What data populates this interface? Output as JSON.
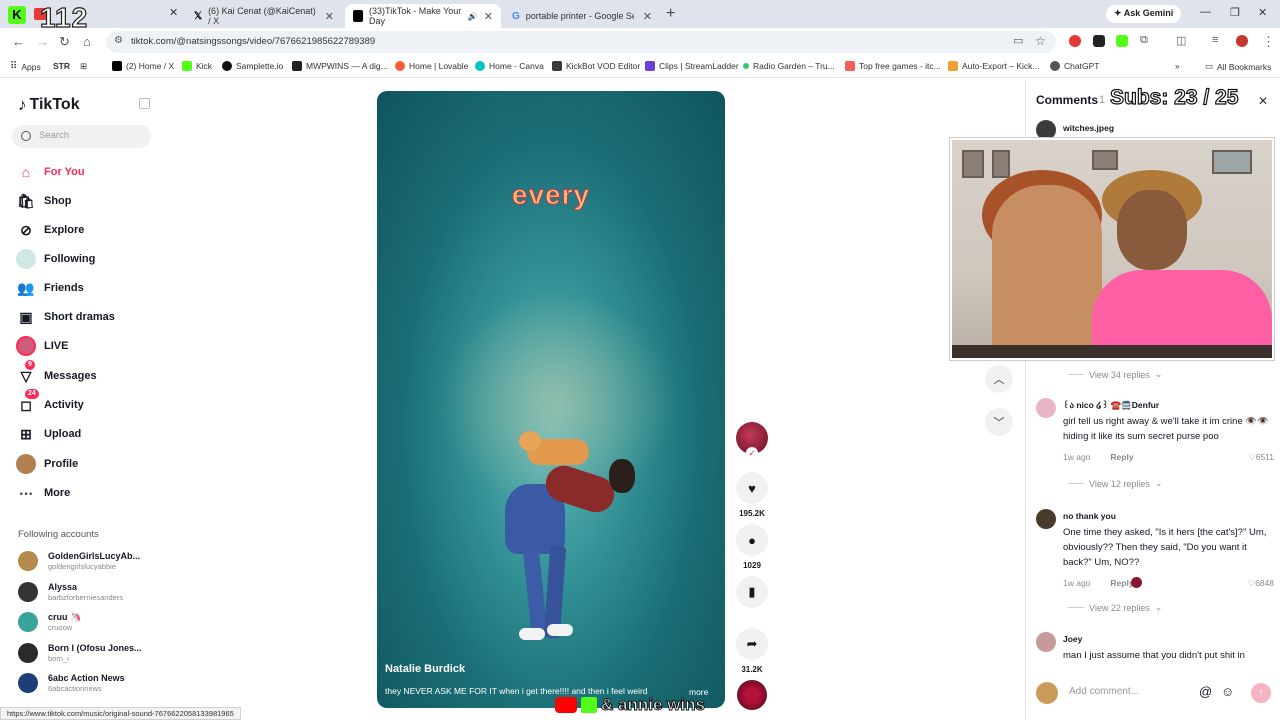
{
  "browser": {
    "overlay_count": "112",
    "tabs": [
      {
        "title": "(6) Kai Cenat (@KaiCenat) / X",
        "fav": "#000000"
      },
      {
        "title": "(33)TikTok - Make Your Day",
        "fav": "#000000"
      },
      {
        "title": "portable printer - Google Search",
        "fav": "#4285f4"
      }
    ],
    "new_tab": "+",
    "gemini": "Ask Gemini",
    "url": "tiktok.com/@natsingssongs/video/7676621985622789389",
    "bookmarks": [
      "Apps",
      "STR",
      "(2) Home / X",
      "Kick",
      "Samplette.io",
      "MWPWINS — A dig...",
      "Home | Lovable",
      "Home - Canva",
      "KickBot VOD Editor",
      "Clips | StreamLadder",
      "Radio Garden – Tru...",
      "Top free games - itc...",
      "Auto-Export – Kick...",
      "ChatGPT"
    ],
    "all_bookmarks": "All Bookmarks",
    "status_url": "https://www.tiktok.com/music/original-sound-7676622058133981965"
  },
  "sidebar": {
    "logo": "TikTok",
    "search_placeholder": "Search",
    "nav": [
      {
        "label": "For You",
        "icon": "home-icon",
        "glyph": "⌂"
      },
      {
        "label": "Shop",
        "icon": "shop-bag-icon",
        "glyph": "🛍"
      },
      {
        "label": "Explore",
        "icon": "compass-icon",
        "glyph": "⊘"
      },
      {
        "label": "Following",
        "icon": "following-avatar-icon",
        "glyph": ""
      },
      {
        "label": "Friends",
        "icon": "friends-icon",
        "glyph": "👥"
      },
      {
        "label": "Short dramas",
        "icon": "film-icon",
        "glyph": "▣"
      },
      {
        "label": "LIVE",
        "icon": "live-avatar-icon",
        "glyph": ""
      },
      {
        "label": "Messages",
        "icon": "messages-icon",
        "glyph": "▽",
        "badge": "9"
      },
      {
        "label": "Activity",
        "icon": "activity-icon",
        "glyph": "◻",
        "badge": "24"
      },
      {
        "label": "Upload",
        "icon": "upload-icon",
        "glyph": "⊞"
      },
      {
        "label": "Profile",
        "icon": "profile-avatar-icon",
        "glyph": ""
      },
      {
        "label": "More",
        "icon": "more-icon",
        "glyph": "⋯"
      }
    ],
    "following_header": "Following accounts",
    "accounts": [
      {
        "name": "GoldenGirlsLucyAb...",
        "handle": "goldengirlslucyabbie",
        "color": "#b58a4a"
      },
      {
        "name": "Alyssa",
        "handle": "barbzforberniesanders",
        "color": "#333333"
      },
      {
        "name": "cruu 🦄",
        "handle": "cruoow",
        "color": "#3aa39a"
      },
      {
        "name": "Born I (Ofosu Jones...",
        "handle": "born_i",
        "color": "#2a2a2a"
      },
      {
        "name": "6abc Action News",
        "handle": "6abcactionnews",
        "color": "#1d3e78"
      }
    ]
  },
  "video": {
    "caption_word": "every",
    "author": "Natalie Burdick",
    "description": "they NEVER ASK ME FOR IT when i get there!!!! and then i feel weird",
    "more": "more",
    "stream_overlay": "& annie wins"
  },
  "actions": {
    "likes": "195.2K",
    "comments": "1029",
    "saves": "",
    "shares": "31.2K"
  },
  "comments_panel": {
    "title": "Comments",
    "count": "1",
    "subs_overlay": "Subs: 23 / 25",
    "top_comment_user": "witches.jpeg",
    "comments": [
      {
        "user": "꒰ა nico ໒꒱ ☎️🚍Denfur",
        "text": "girl tell us right away & we'll take it im crine 👁️👁️ hiding it like its sum secret purse poo",
        "time": "1w ago",
        "reply": "Reply",
        "likes": "6511",
        "color": "#e8b4c7"
      },
      {
        "user": "no thank you",
        "text": "One time they asked, \"Is it hers [the cat's]?\" Um, obviously?? Then they said, \"Do you want it back?\" Um, NO??",
        "time": "1w ago",
        "reply": "Reply",
        "likes": "6848",
        "color": "#4a3a2a"
      },
      {
        "user": "Joey",
        "text": "man I just assume that you didn't put shit in",
        "time": "",
        "reply": "",
        "likes": "",
        "color": "#c49a9a"
      }
    ],
    "view_replies": [
      "View 34 replies",
      "View 12 replies",
      "View 22 replies"
    ],
    "add_comment_placeholder": "Add comment..."
  }
}
